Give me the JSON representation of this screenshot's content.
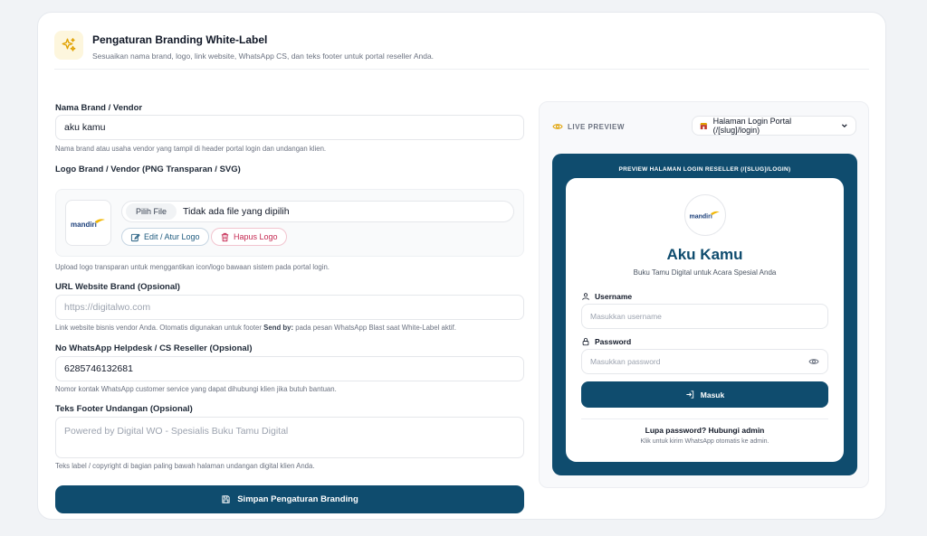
{
  "header": {
    "title": "Pengaturan Branding White-Label",
    "subtitle": "Sesuaikan nama brand, logo, link website, WhatsApp CS, dan teks footer untuk portal reseller Anda.",
    "icon": "sparkles-icon"
  },
  "form": {
    "brand_name": {
      "label": "Nama Brand / Vendor",
      "value": "aku kamu",
      "help": "Nama brand atau usaha vendor yang tampil di header portal login dan undangan klien."
    },
    "logo": {
      "label": "Logo Brand / Vendor (PNG Transparan / SVG)",
      "logo_text": "mandiri",
      "file_button": "Pilih File",
      "file_status": "Tidak ada file yang dipilih",
      "edit_label": "Edit / Atur Logo",
      "delete_label": "Hapus Logo",
      "help": "Upload logo transparan untuk menggantikan icon/logo bawaan sistem pada portal login."
    },
    "website": {
      "label": "URL Website Brand (Opsional)",
      "placeholder": "https://digitalwo.com",
      "help_pre": "Link website bisnis vendor Anda. Otomatis digunakan untuk footer ",
      "help_bold": "Send by:",
      "help_post": " pada pesan WhatsApp Blast saat White-Label aktif."
    },
    "whatsapp": {
      "label": "No WhatsApp Helpdesk / CS Reseller (Opsional)",
      "value": "6285746132681",
      "help": "Nomor kontak WhatsApp customer service yang dapat dihubungi klien jika butuh bantuan."
    },
    "footer": {
      "label": "Teks Footer Undangan (Opsional)",
      "placeholder": "Powered by Digital WO - Spesialis Buku Tamu Digital",
      "help": "Teks label / copyright di bagian paling bawah halaman undangan digital klien Anda."
    },
    "save_label": "Simpan Pengaturan Branding"
  },
  "preview": {
    "live_label": "LIVE PREVIEW",
    "select_value": "Halaman Login Portal (/[slug]/login)",
    "frame_title": "PREVIEW HALAMAN LOGIN RESELLER (/[SLUG]/LOGIN)",
    "login": {
      "logo_text": "mandiri",
      "brand": "Aku Kamu",
      "subtitle": "Buku Tamu Digital untuk Acara Spesial Anda",
      "username_label": "Username",
      "username_placeholder": "Masukkan username",
      "password_label": "Password",
      "password_placeholder": "Masukkan password",
      "submit_label": "Masuk",
      "forgot": "Lupa password? Hubungi admin",
      "forgot_sub": "Klik untuk kirim WhatsApp otomatis ke admin."
    }
  },
  "colors": {
    "primary": "#0f4c6e",
    "danger": "#c52952",
    "accent_gold": "#f2b705"
  }
}
